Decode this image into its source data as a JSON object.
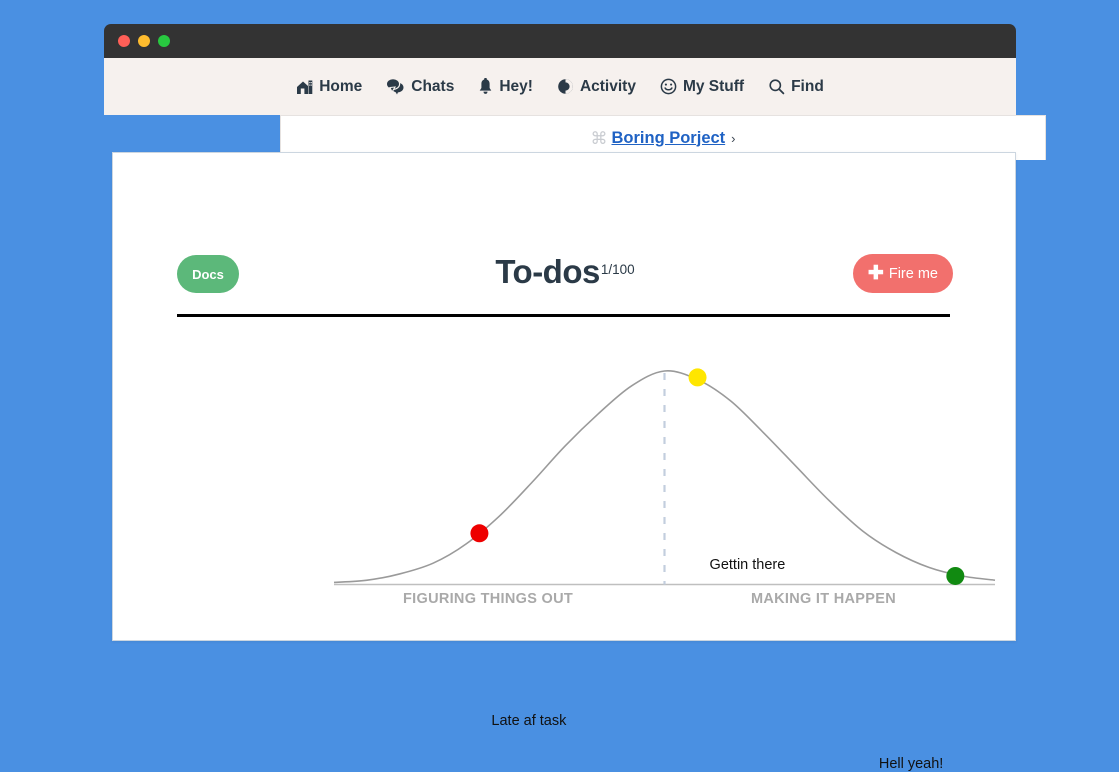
{
  "window": {
    "traffic_lights": [
      {
        "name": "close",
        "color": "#ff5f57"
      },
      {
        "name": "minimize",
        "color": "#febc2e"
      },
      {
        "name": "zoom",
        "color": "#28c840"
      }
    ]
  },
  "nav": {
    "items": [
      {
        "label": "Home",
        "icon": "home-icon"
      },
      {
        "label": "Chats",
        "icon": "chat-bubbles-icon"
      },
      {
        "label": "Hey!",
        "icon": "bell-icon"
      },
      {
        "label": "Activity",
        "icon": "pie-chart-icon"
      },
      {
        "label": "My Stuff",
        "icon": "smiley-face-icon"
      },
      {
        "label": "Find",
        "icon": "search-icon"
      }
    ]
  },
  "breadcrumb": {
    "cmd_symbol": "⌘",
    "project": "Boring Porject",
    "chevron": "›"
  },
  "header": {
    "docs_label": "Docs",
    "docs_color": "#5cb87a",
    "title": "To-dos",
    "count": "1/100",
    "fire_label": "Fire me",
    "fire_plus": "✚",
    "fire_color": "#f2706d"
  },
  "chart_data": {
    "type": "line",
    "title": "To-dos",
    "xlabel": "",
    "ylabel": "",
    "grid": false,
    "legend": "none",
    "curve": "bell",
    "xlim": [
      0,
      100
    ],
    "ylim": [
      0,
      100
    ],
    "x": [
      0,
      5,
      10,
      15,
      20,
      25,
      30,
      35,
      40,
      45,
      50,
      55,
      60,
      65,
      70,
      75,
      80,
      85,
      90,
      95,
      100
    ],
    "y": [
      1,
      2,
      5,
      10,
      19,
      32,
      48,
      65,
      80,
      93,
      100,
      96,
      86,
      71,
      55,
      39,
      25,
      15,
      8,
      4,
      2
    ],
    "axis_sections": [
      {
        "label": "FIGURING THINGS OUT",
        "color": "#a9a9a9"
      },
      {
        "label": "MAKING IT HAPPEN",
        "color": "#a9a9a9"
      }
    ],
    "markers": [
      {
        "label": "Late af task",
        "color": "#ee0000",
        "x": 22,
        "y": 24,
        "label_side": "right"
      },
      {
        "label": "Gettin there",
        "color": "#ffe600",
        "x": 55,
        "y": 97,
        "label_side": "right"
      },
      {
        "label": "Hell yeah!",
        "color": "#118a11",
        "x": 94,
        "y": 4,
        "label_side": "left"
      }
    ],
    "peak_marker": {
      "x": 50,
      "style": "dashed",
      "color": "#c3cede"
    }
  }
}
